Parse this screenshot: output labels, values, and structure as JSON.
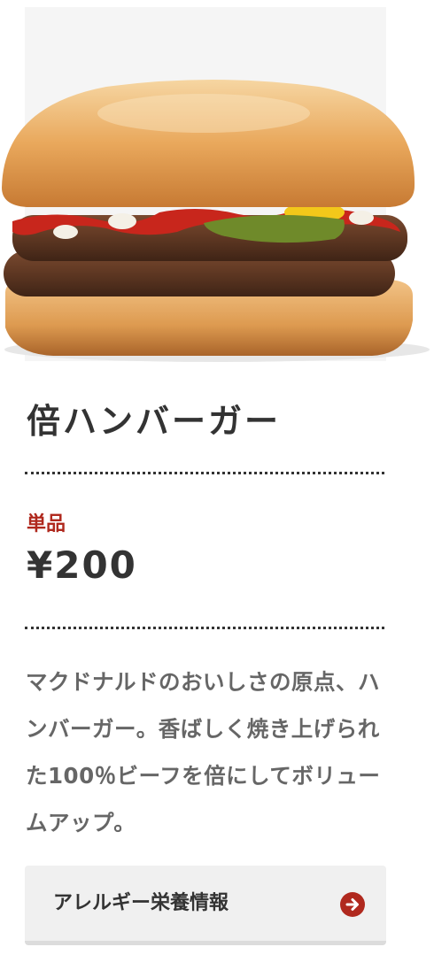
{
  "product": {
    "name": "倍ハンバーガー",
    "image_alt": "hamburger-image",
    "price_label": "単品",
    "price": "¥200",
    "description": "マクドナルドのおいしさの原点、ハンバーガー。香ばしく焼き上げられた100％ビーフを倍にしてボリュームアップ。"
  },
  "allergy_button": {
    "label": "アレルギー栄養情報",
    "icon": "arrow-right-circle-icon"
  },
  "colors": {
    "accent": "#b0291e",
    "text": "#333333",
    "description_text": "#666666",
    "button_bg": "#f0f0f0",
    "image_bg": "#f5f5f5"
  }
}
